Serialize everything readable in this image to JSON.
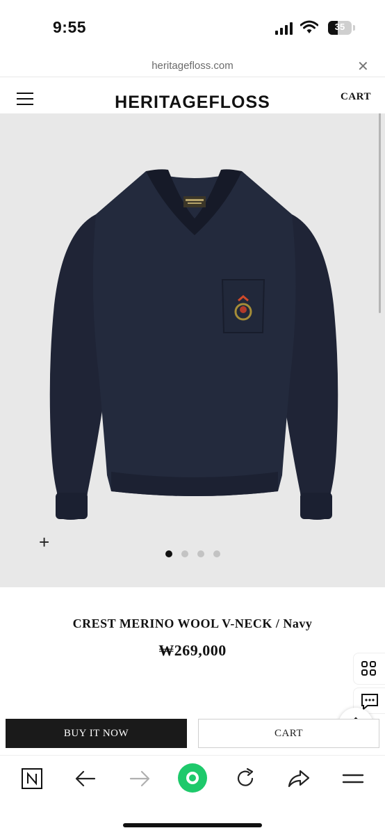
{
  "status_bar": {
    "time": "9:55",
    "battery": "35",
    "icons": [
      "cellular-signal-icon",
      "wifi-icon",
      "battery-icon"
    ]
  },
  "url_bar": {
    "url": "heritagefloss.com",
    "close_icon": "close-icon"
  },
  "header": {
    "brand": "HERITAGEFLOSS",
    "cart_label": "CART",
    "menu_icon": "hamburger-menu-icon"
  },
  "gallery": {
    "image_count": 4,
    "active_index": 0,
    "zoom_icon": "plus-icon",
    "image_subject": "navy-v-neck-sweater-with-crest-pocket"
  },
  "product": {
    "title": "CREST MERINO WOOL V-NECK / Navy",
    "price": "₩269,000"
  },
  "actions": {
    "buy_now_label": "BUY IT NOW",
    "cart_label": "CART"
  },
  "floating": {
    "icons": [
      "grid-icon",
      "chat-icon",
      "arrow-up-icon"
    ]
  },
  "toolbar": {
    "icons": [
      "naver-n-icon",
      "back-arrow-icon",
      "forward-arrow-icon",
      "green-home-icon",
      "reload-icon",
      "share-icon",
      "menu-lines-icon"
    ]
  },
  "colors": {
    "sweater": "#1f2436",
    "accent_green": "#1ec96b",
    "image_bg": "#e8e8e8",
    "buy_button": "#1a1a1a"
  }
}
